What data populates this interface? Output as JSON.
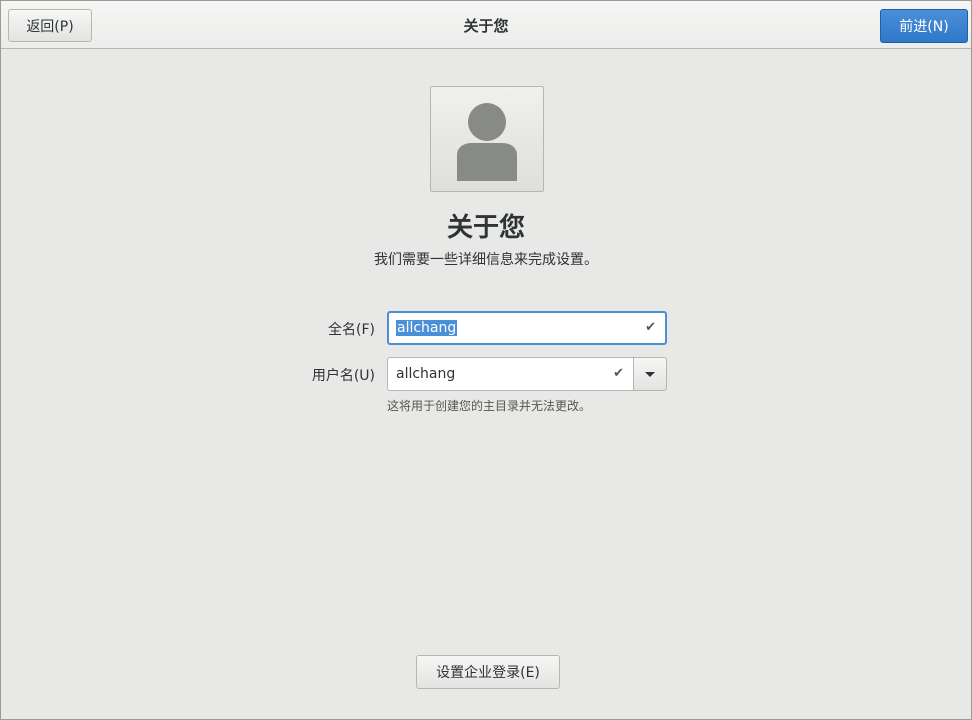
{
  "header": {
    "back_label": "返回(P)",
    "title": "关于您",
    "next_label": "前进(N)"
  },
  "avatar": {
    "icon": "avatar-icon"
  },
  "main": {
    "title": "关于您",
    "subtitle": "我们需要一些详细信息来完成设置。",
    "fullname": {
      "label": "全名(F)",
      "value": "allchang",
      "valid": true
    },
    "username": {
      "label": "用户名(U)",
      "value": "allchang",
      "valid": true,
      "hint": "这将用于创建您的主目录并无法更改。"
    },
    "check_glyph": "✔"
  },
  "footer": {
    "enterprise_label": "设置企业登录(E)"
  },
  "colors": {
    "accent": "#4a90d9",
    "background": "#e8e8e7"
  }
}
